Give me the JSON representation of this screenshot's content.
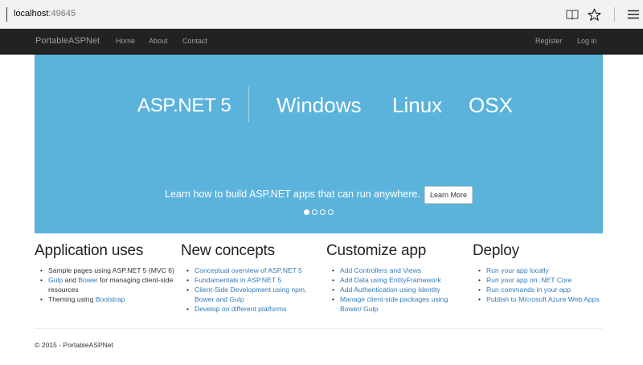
{
  "browser": {
    "address_host": "localhost",
    "address_port": ":49645",
    "icons": [
      "reading-view-icon",
      "favorite-star-icon",
      "menu-icon"
    ]
  },
  "navbar": {
    "brand": "PortableASPNet",
    "links": [
      "Home",
      "About",
      "Contact"
    ],
    "right_links": [
      "Register",
      "Log in"
    ]
  },
  "carousel": {
    "brand": "ASP.NET 5",
    "platforms": [
      "Windows",
      "Linux",
      "OSX"
    ],
    "caption": "Learn how to build ASP.NET apps that can run anywhere.",
    "button": "Learn More",
    "slide_count": 4,
    "active_slide": 1,
    "background": "#5bb3dc"
  },
  "columns": [
    {
      "title": "Application uses",
      "items": [
        {
          "parts": [
            {
              "text": "Sample pages using ASP.NET 5 (MVC 6)"
            }
          ]
        },
        {
          "parts": [
            {
              "text": "Gulp",
              "link": true
            },
            {
              "text": " and "
            },
            {
              "text": "Bower",
              "link": true
            },
            {
              "text": " for managing client-side resources"
            }
          ]
        },
        {
          "parts": [
            {
              "text": "Theming using "
            },
            {
              "text": "Bootstrap",
              "link": true
            }
          ]
        }
      ]
    },
    {
      "title": "New concepts",
      "items": [
        {
          "parts": [
            {
              "text": "Conceptual overview of ASP.NET 5",
              "link": true
            }
          ]
        },
        {
          "parts": [
            {
              "text": "Fundamentals in ASP.NET 5",
              "link": true
            }
          ]
        },
        {
          "parts": [
            {
              "text": "Client-Side Development using npm, Bower and Gulp",
              "link": true
            }
          ]
        },
        {
          "parts": [
            {
              "text": "Develop on different platforms",
              "link": true
            }
          ]
        }
      ]
    },
    {
      "title": "Customize app",
      "items": [
        {
          "parts": [
            {
              "text": "Add Controllers and Views",
              "link": true
            }
          ]
        },
        {
          "parts": [
            {
              "text": "Add Data using EntityFramework",
              "link": true
            }
          ]
        },
        {
          "parts": [
            {
              "text": "Add Authentication using Identity",
              "link": true
            }
          ]
        },
        {
          "parts": [
            {
              "text": "Manage client-side packages using Bower/ Gulp",
              "link": true
            }
          ]
        }
      ]
    },
    {
      "title": "Deploy",
      "items": [
        {
          "parts": [
            {
              "text": "Run your app locally",
              "link": true
            }
          ]
        },
        {
          "parts": [
            {
              "text": "Run your app on .NET Core",
              "link": true
            }
          ]
        },
        {
          "parts": [
            {
              "text": "Run commands in your app",
              "link": true
            }
          ]
        },
        {
          "parts": [
            {
              "text": "Publish to Microsoft Azure Web Apps",
              "link": true
            }
          ]
        }
      ]
    }
  ],
  "footer": "© 2015 - PortableASPNet"
}
